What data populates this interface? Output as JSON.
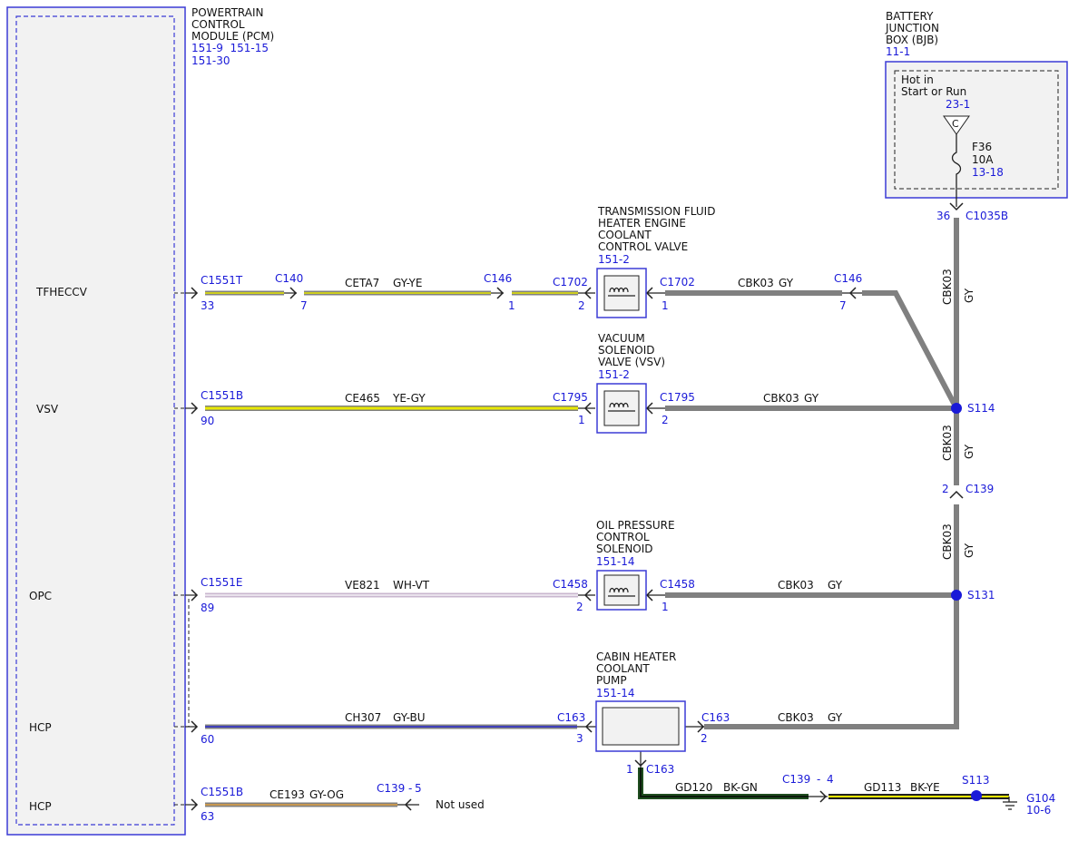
{
  "colors": {
    "ref_blue": "#1a1ad8",
    "module_border": "#3b3bd6",
    "module_fill": "#f2f2f2",
    "gray_wire": "#808080",
    "yellow": "#e8e800",
    "green_wire": "#1f4d1f"
  },
  "pcm": {
    "title_lines": [
      "POWERTRAIN",
      "CONTROL",
      "MODULE (PCM)"
    ],
    "refs": [
      "151-9  151-15",
      "151-30"
    ],
    "pins": [
      "TFHECCV",
      "VSV",
      "OPC",
      "HCP",
      "HCP"
    ]
  },
  "bjb": {
    "title_lines": [
      "BATTERY",
      "JUNCTION",
      "BOX (BJB)"
    ],
    "ref": "11-1",
    "hot_lines": [
      "Hot in",
      "Start or Run"
    ],
    "hot_ref": "23-1",
    "bus": "C",
    "fuse_name": "F36",
    "fuse_rating": "10A",
    "fuse_ref": "13-18",
    "conn_pin": "36",
    "conn": "C1035B"
  },
  "components": {
    "tfh": {
      "title_lines": [
        "TRANSMISSION FLUID",
        "HEATER ENGINE",
        "COOLANT",
        "CONTROL VALVE"
      ],
      "ref": "151-2"
    },
    "vsv": {
      "title_lines": [
        "VACUUM",
        "SOLENOID",
        "VALVE (VSV)"
      ],
      "ref": "151-2"
    },
    "opc": {
      "title_lines": [
        "OIL PRESSURE",
        "CONTROL",
        "SOLENOID"
      ],
      "ref": "151-14"
    },
    "pump": {
      "title_lines": [
        "CABIN HEATER",
        "COOLANT",
        "PUMP"
      ],
      "ref": "151-14"
    }
  },
  "circuits": {
    "r1": {
      "pcm_conn": "C1551T",
      "pcm_pin": "33",
      "c140": "C140",
      "c140_pin": "7",
      "wire": "CETA7",
      "color": "GY-YE",
      "c146": "C146",
      "c146_pin": "1",
      "comp_left": "C1702",
      "comp_left_pin": "2",
      "comp_right": "C1702",
      "comp_right_pin": "1",
      "right_wire": "CBK03",
      "right_color": "GY",
      "c146b": "C146",
      "c146b_pin": "7"
    },
    "r2": {
      "pcm_conn": "C1551B",
      "pcm_pin": "90",
      "wire": "CE465",
      "color": "YE-GY",
      "comp_left": "C1795",
      "comp_left_pin": "1",
      "comp_right": "C1795",
      "comp_right_pin": "2",
      "right_wire": "CBK03",
      "right_color": "GY"
    },
    "r3": {
      "pcm_conn": "C1551E",
      "pcm_pin": "89",
      "wire": "VE821",
      "color": "WH-VT",
      "comp_left": "C1458",
      "comp_left_pin": "2",
      "comp_right": "C1458",
      "comp_right_pin": "1",
      "right_wire": "CBK03",
      "right_color": "GY"
    },
    "r4": {
      "pcm_pin": "60",
      "wire": "CH307",
      "color": "GY-BU",
      "comp_left": "C163",
      "comp_left_pin": "3",
      "comp_right": "C163",
      "comp_right_pin": "2",
      "right_wire": "CBK03",
      "right_color": "GY",
      "bottom_pin": "1",
      "bottom_conn": "C163"
    },
    "r5": {
      "pcm_conn": "C1551B",
      "pcm_pin": "63",
      "wire": "CE193",
      "color": "GY-OG",
      "end_conn": "C139",
      "end_dash": "-",
      "end_pin": "5",
      "note": "Not used"
    },
    "ground": {
      "wire1": "GD120",
      "color1": "BK-GN",
      "conn": "C139",
      "dash": "-",
      "conn_pin": "4",
      "wire2": "GD113",
      "color2": "BK-YE",
      "splice": "S113",
      "ground": "G104",
      "ground_ref": "10-6"
    },
    "trunk": {
      "seg1_wire": "CBK03",
      "seg1_color": "GY",
      "s114": "S114",
      "seg2_wire": "CBK03",
      "seg2_color": "GY",
      "c139_pin": "2",
      "c139": "C139",
      "seg3_wire": "CBK03",
      "seg3_color": "GY",
      "s131": "S131"
    }
  }
}
